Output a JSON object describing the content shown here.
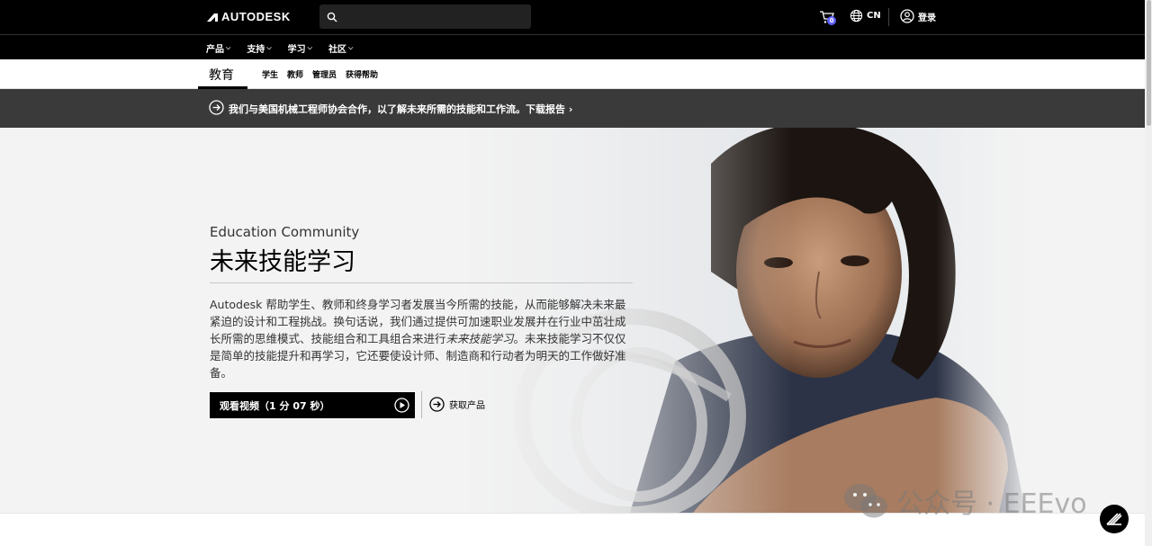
{
  "header": {
    "brand": "AUTODESK",
    "search": {
      "placeholder": "",
      "value": ""
    },
    "cart_count": "0",
    "language": "CN",
    "signin_label": "登录"
  },
  "nav": {
    "items": [
      {
        "label": "产品"
      },
      {
        "label": "支持"
      },
      {
        "label": "学习"
      },
      {
        "label": "社区"
      }
    ]
  },
  "subnav": {
    "title": "教育",
    "links": [
      {
        "label": "学生"
      },
      {
        "label": "教师"
      },
      {
        "label": "管理员"
      },
      {
        "label": "获得帮助"
      }
    ]
  },
  "announcement": {
    "text": "我们与美国机械工程师协会合作，以了解未来所需的技能和工作流。下载报告 ›"
  },
  "hero": {
    "eyebrow": "Education Community",
    "title": "未来技能学习",
    "body_part1": "Autodesk 帮助学生、教师和终身学习者发展当今所需的技能，从而能够解决未来最紧迫的设计和工程挑战。换句话说，我们通过提供可加速职业发展并在行业中茁壮成长所需的思维模式、技能组合和工具组合来进行",
    "body_em": "未来技能学习",
    "body_part2": "。未来技能学习不仅仅是简单的技能提升和再学习，它还要使设计师、制造商和行动者为明天的工作做好准备。",
    "video_button": "观看视频（1 分 07 秒）",
    "products_link": "获取产品"
  },
  "watermark": {
    "text": "公众号 · EEEvo"
  },
  "colors": {
    "topbar_bg": "#000000",
    "announce_bg": "#3a3a3a",
    "hero_bg": "#f3f3f3",
    "cart_badge": "#5f60ff"
  },
  "icons": [
    "autodesk-logo-icon",
    "search-icon",
    "cart-icon",
    "globe-icon",
    "user-icon",
    "chevron-down-icon",
    "arrow-circle-icon",
    "play-icon",
    "chat-icon",
    "wechat-icon"
  ]
}
